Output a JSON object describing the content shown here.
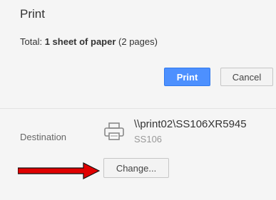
{
  "header": {
    "title": "Print"
  },
  "summary": {
    "total_label": "Total:",
    "sheets": "1 sheet of paper",
    "pages": "(2 pages)"
  },
  "actions": {
    "print_label": "Print",
    "cancel_label": "Cancel"
  },
  "destination": {
    "label": "Destination",
    "printer_name": "\\\\print02\\SS106XR5945",
    "printer_subtitle": "SS106",
    "change_label": "Change..."
  },
  "colors": {
    "primary_button": "#4d90fe",
    "arrow": "#e00000"
  },
  "icons": {
    "printer": "printer-icon",
    "annotation": "red-arrow-icon"
  }
}
